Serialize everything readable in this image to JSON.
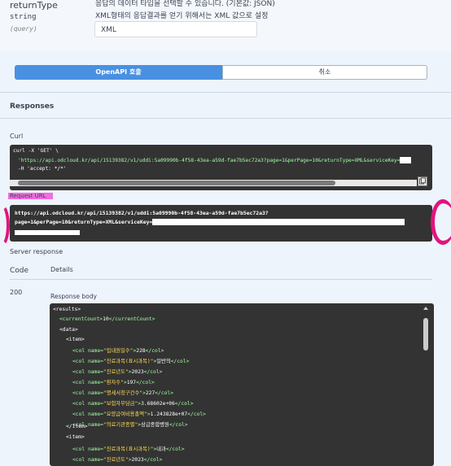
{
  "param": {
    "name": "returnType",
    "type": "string",
    "in": "(query)",
    "description_line1": "응답의 데이터 타입을 선택할 수 있습니다. (기본값: JSON)",
    "description_line2": "XML형태의 응답결과를 얻기 위해서는 XML 값으로 설정",
    "value": "XML"
  },
  "buttons": {
    "execute": "OpenAPI 호출",
    "clear": "취소"
  },
  "responses": {
    "title": "Responses",
    "curl_label": "Curl",
    "curl_line1": "curl -X 'GET' \\",
    "curl_line2": "'https://api.odcloud.kr/api/15139382/v1/uddi:5a09990b-4f58-43ea-a59d-fae7b5ec72a3?page=1&perPage=10&returnType=XML&serviceKey=",
    "curl_line3": "-H 'accept: */*'",
    "request_url_label": "Request URL",
    "request_url_line1": "https://api.odcloud.kr/api/15139382/v1/uddi:5a09990b-4f58-43ea-a59d-fae7b5ec72a3?",
    "request_url_line2": "page=1&perPage=10&returnType=XML&serviceKey=",
    "server_response": "Server response",
    "col_code": "Code",
    "col_details": "Details",
    "status_code": "200",
    "response_body_label": "Response body"
  },
  "response_body": {
    "results_open": "<results>",
    "current_count_open": "<currentCount>",
    "current_count_value": "10",
    "current_count_close": "</currentCount>",
    "data_open": "<data>",
    "item_open": "<item>",
    "item_close": "</item>",
    "col_prefix": "<col name=",
    "col_close": "</col>",
    "item1": [
      {
        "name": "\"입내원일수\"",
        "value": "228"
      },
      {
        "name": "\"진료과목(표시과목)\"",
        "value": "일반의"
      },
      {
        "name": "\"진료년도\"",
        "value": "2023"
      },
      {
        "name": "\"환자수\"",
        "value": "197"
      },
      {
        "name": "\"명세서청구건수\"",
        "value": "227"
      },
      {
        "name": "\"보험자부담금\"",
        "value": "3.68602e+06"
      },
      {
        "name": "\"요양급여비용총액\"",
        "value": "1.243828e+07"
      },
      {
        "name": "\"의료기관종별\"",
        "value": "상급종합병원"
      }
    ],
    "item2": [
      {
        "name": "\"진료과목(표시과목)\"",
        "value": "내과"
      },
      {
        "name": "\"진료년도\"",
        "value": "2023"
      }
    ]
  }
}
